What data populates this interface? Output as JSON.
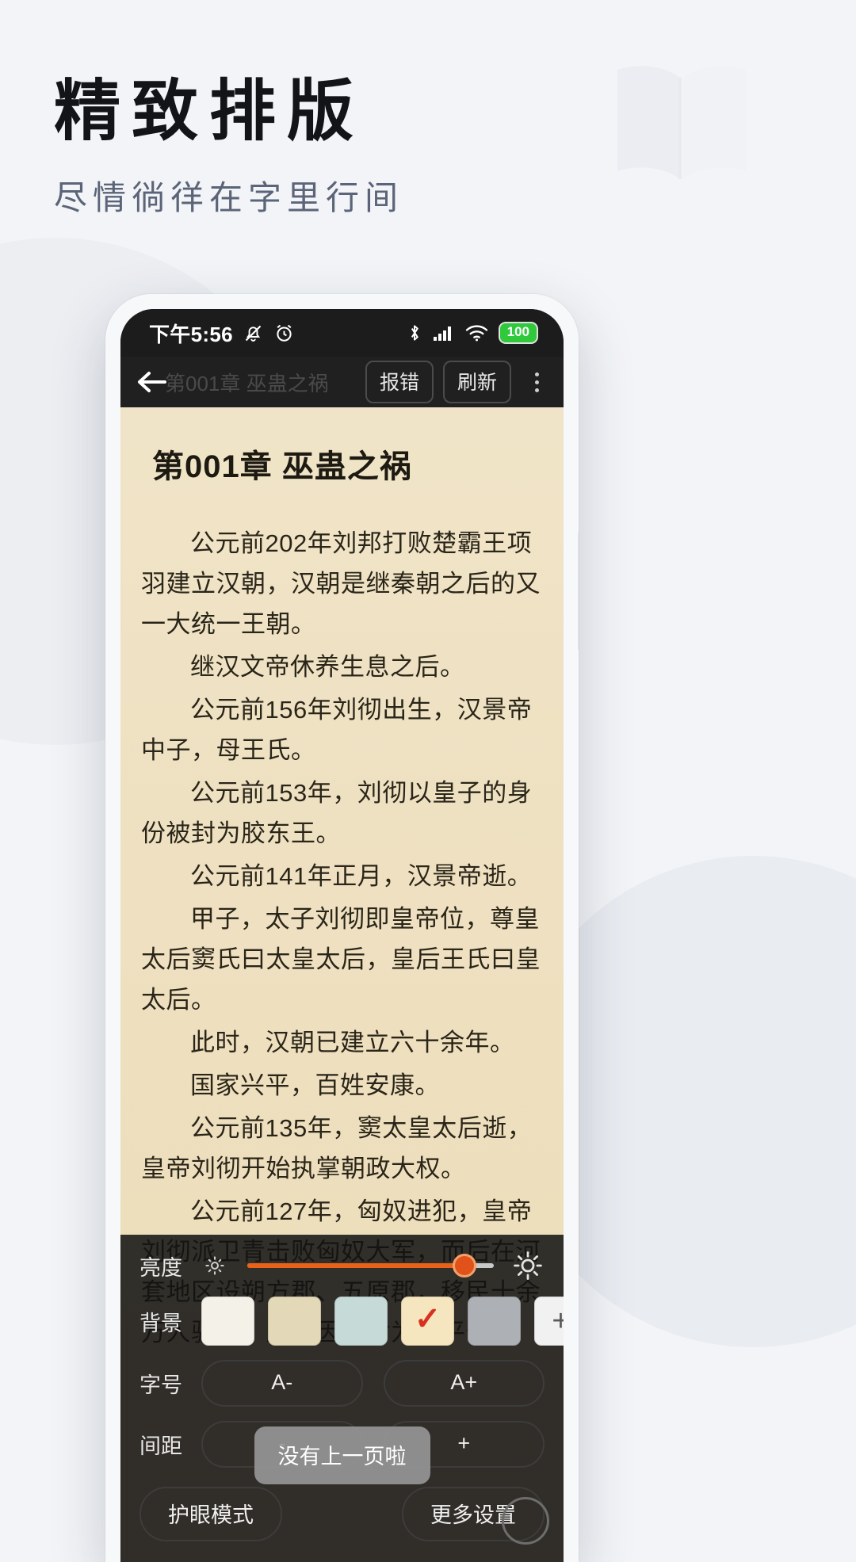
{
  "promo": {
    "title": "精致排版",
    "subtitle": "尽情徜徉在字里行间",
    "book_icon": "open-book-icon"
  },
  "phone": {
    "statusbar": {
      "time": "下午5:56",
      "icons_left": [
        "mute-bell-icon",
        "alarm-clock-icon"
      ],
      "icons_right": [
        "bluetooth-icon",
        "cellular-signal-icon",
        "wifi-icon"
      ],
      "battery_level": "100"
    },
    "toolbar": {
      "back_icon": "back-arrow-icon",
      "title": "第001章 巫蛊之祸",
      "report_label": "报错",
      "refresh_label": "刷新",
      "more_icon": "more-vertical-icon"
    },
    "reader": {
      "chapter_title": "第001章 巫蛊之祸",
      "paragraphs": [
        "公元前202年刘邦打败楚霸王项羽建立汉朝，汉朝是继秦朝之后的又一大统一王朝。",
        "继汉文帝休养生息之后。",
        "公元前156年刘彻出生，汉景帝中子，母王氏。",
        "公元前153年，刘彻以皇子的身份被封为胶东王。",
        "公元前141年正月，汉景帝逝。",
        "甲子，太子刘彻即皇帝位，尊皇太后窦氏曰太皇太后，皇后王氏曰皇太后。",
        "此时，汉朝已建立六十余年。",
        "国家兴平，百姓安康。",
        "公元前135年，窦太皇太后逝，皇帝刘彻开始执掌朝政大权。",
        "公元前127年，匈奴进犯，皇帝刘彻派卫青击败匈奴大军，而后在河套地区设朔方郡、五原郡，移民十余万人驻守，卫青因功封为长平侯。"
      ],
      "background_color": "#efe2c4",
      "text_color": "#2a2519"
    },
    "settings": {
      "brightness": {
        "label": "亮度",
        "min_icon": "sun-small-icon",
        "max_icon": "sun-large-icon",
        "value_percent": 88,
        "accent_color": "#e8621a"
      },
      "background": {
        "label": "背景",
        "swatches": [
          {
            "name": "swatch-white",
            "color": "#f4f1e8",
            "selected": false
          },
          {
            "name": "swatch-beige",
            "color": "#e3d9b8",
            "selected": false
          },
          {
            "name": "swatch-mint",
            "color": "#c6dad8",
            "selected": false
          },
          {
            "name": "swatch-cream",
            "color": "#f6e6c0",
            "selected": true
          },
          {
            "name": "swatch-gray",
            "color": "#adb0b5",
            "selected": false
          }
        ],
        "add_label": "+",
        "check_color": "#d8301e"
      },
      "font_size": {
        "label": "字号",
        "decrease_label": "A-",
        "increase_label": "A+"
      },
      "line_spacing": {
        "label": "间距",
        "decrease_label": "-",
        "increase_label": "+"
      },
      "eye_protection_label": "护眼模式",
      "more_settings_label": "更多设置",
      "fab_icon": "circle-fab-icon"
    },
    "toast": {
      "message": "没有上一页啦"
    }
  }
}
